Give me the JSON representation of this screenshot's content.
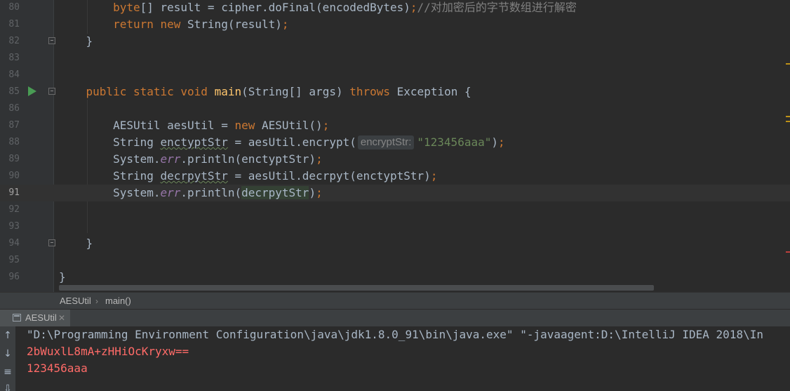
{
  "editor": {
    "lines": [
      {
        "num": "80",
        "code": [
          {
            "t": "        "
          },
          {
            "t": "byte",
            "c": "kw"
          },
          {
            "t": "[] result = cipher.doFinal(encodedBytes)"
          },
          {
            "t": ";",
            "c": "kw"
          },
          {
            "t": "//对加密后的字节数组进行解密",
            "c": "cm"
          }
        ]
      },
      {
        "num": "81",
        "code": [
          {
            "t": "        "
          },
          {
            "t": "return new",
            "c": "kw"
          },
          {
            "t": " String(result)"
          },
          {
            "t": ";",
            "c": "kw"
          }
        ]
      },
      {
        "num": "82",
        "code": [
          {
            "t": "    }"
          }
        ]
      },
      {
        "num": "83",
        "code": []
      },
      {
        "num": "84",
        "code": []
      },
      {
        "num": "85",
        "code": [
          {
            "t": "    "
          },
          {
            "t": "public static void ",
            "c": "kw"
          },
          {
            "t": "main",
            "c": "fn"
          },
          {
            "t": "(String[] args) "
          },
          {
            "t": "throws ",
            "c": "kw"
          },
          {
            "t": "Exception {"
          }
        ]
      },
      {
        "num": "86",
        "code": []
      },
      {
        "num": "87",
        "code": [
          {
            "t": "        AESUtil aesUtil = "
          },
          {
            "t": "new ",
            "c": "kw"
          },
          {
            "t": "AESUtil()"
          },
          {
            "t": ";",
            "c": "kw"
          }
        ]
      },
      {
        "num": "88",
        "code": [
          {
            "t": "        String "
          },
          {
            "t": "enctyptStr",
            "c": "warn"
          },
          {
            "t": " = aesUtil.encrypt("
          },
          {
            "hint": "encryptStr:"
          },
          {
            "t": "\"123456aaa\"",
            "c": "str"
          },
          {
            "t": ")"
          },
          {
            "t": ";",
            "c": "kw"
          }
        ]
      },
      {
        "num": "89",
        "code": [
          {
            "t": "        System."
          },
          {
            "t": "err",
            "c": "it"
          },
          {
            "t": ".println(enctyptStr)"
          },
          {
            "t": ";",
            "c": "kw"
          }
        ]
      },
      {
        "num": "90",
        "code": [
          {
            "t": "        String "
          },
          {
            "t": "decrpytStr",
            "c": "warn"
          },
          {
            "t": " = aesUtil.decrpyt(enctyptStr)"
          },
          {
            "t": ";",
            "c": "kw"
          }
        ]
      },
      {
        "num": "91",
        "current": true,
        "code": [
          {
            "t": "        System."
          },
          {
            "t": "err",
            "c": "it"
          },
          {
            "t": ".println("
          },
          {
            "t": "decrpytStr",
            "c": "hl"
          },
          {
            "t": ")"
          },
          {
            "t": ";",
            "c": "kw"
          }
        ]
      },
      {
        "num": "92",
        "code": []
      },
      {
        "num": "93",
        "code": []
      },
      {
        "num": "94",
        "code": [
          {
            "t": "    }"
          }
        ]
      },
      {
        "num": "95",
        "code": []
      },
      {
        "num": "96",
        "code": [
          {
            "t": "}"
          }
        ]
      }
    ]
  },
  "breadcrumb": {
    "items": [
      "AESUtil",
      "main()"
    ]
  },
  "run_panel": {
    "tab_label": "AESUtil",
    "console_lines": [
      {
        "text": "\"D:\\Programming Environment Configuration\\java\\jdk1.8.0_91\\bin\\java.exe\" \"-javaagent:D:\\IntelliJ IDEA 2018\\In",
        "color": "#a9b7c6"
      },
      {
        "text": "2bWuxlL8mA+zHHiOcKryxw==",
        "color": "#ff6b68"
      },
      {
        "text": "123456aaa",
        "color": "#ff6b68"
      }
    ]
  },
  "colors": {
    "keyword": "#cc7832",
    "function": "#ffc66d",
    "string": "#6a8759",
    "comment": "#808080",
    "error_output": "#ff6b68",
    "run_arrow": "#499c54"
  }
}
